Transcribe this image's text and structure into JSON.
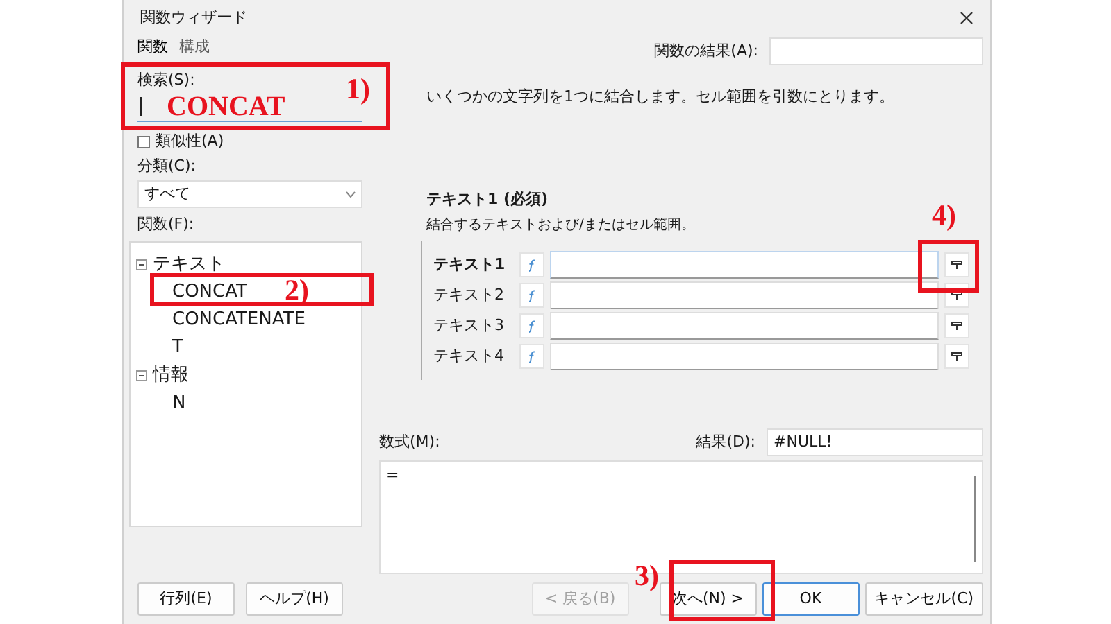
{
  "window": {
    "title": "関数ウィザード"
  },
  "tabs": [
    {
      "label": "関数",
      "selected": true
    },
    {
      "label": "構成",
      "selected": false
    }
  ],
  "search": {
    "label": "検索(S):"
  },
  "similarity": {
    "label": "類似性(A)",
    "checked": false
  },
  "category": {
    "label": "分類(C):",
    "value": "すべて"
  },
  "functions": {
    "label": "関数(F):",
    "tree": [
      {
        "label": "テキスト",
        "expanded": true,
        "children": [
          {
            "label": "CONCAT"
          },
          {
            "label": "CONCATENATE"
          },
          {
            "label": "T"
          }
        ]
      },
      {
        "label": "情報",
        "expanded": true,
        "children": [
          {
            "label": "N"
          }
        ]
      }
    ]
  },
  "left_buttons": [
    {
      "label": "行列(E)"
    },
    {
      "label": "ヘルプ(H)"
    }
  ],
  "function_result": {
    "label": "関数の結果(A):"
  },
  "description": "いくつかの文字列を1つに結合します。セル範囲を引数にとります。",
  "argument_help": {
    "title": "テキスト1 (必須)",
    "text": "結合するテキストおよび/またはセル範囲。"
  },
  "arguments": [
    {
      "label": "テキスト1",
      "focused": true
    },
    {
      "label": "テキスト2",
      "focused": false
    },
    {
      "label": "テキスト3",
      "focused": false
    },
    {
      "label": "テキスト4",
      "focused": false
    }
  ],
  "formula": {
    "label": "数式(M):",
    "value": "="
  },
  "result": {
    "label": "結果(D):",
    "value": "#NULL!"
  },
  "buttons": [
    {
      "label": "< 戻る(B)",
      "disabled": true,
      "default": false
    },
    {
      "label": "次へ(N) >",
      "disabled": false,
      "default": false
    },
    {
      "label": "OK",
      "disabled": false,
      "default": true
    },
    {
      "label": "キャンセル(C)",
      "disabled": false,
      "default": false
    }
  ],
  "annotations": [
    {
      "label": "1)",
      "note": "CONCAT"
    },
    {
      "label": "2)"
    },
    {
      "label": "3)"
    },
    {
      "label": "4)"
    }
  ]
}
